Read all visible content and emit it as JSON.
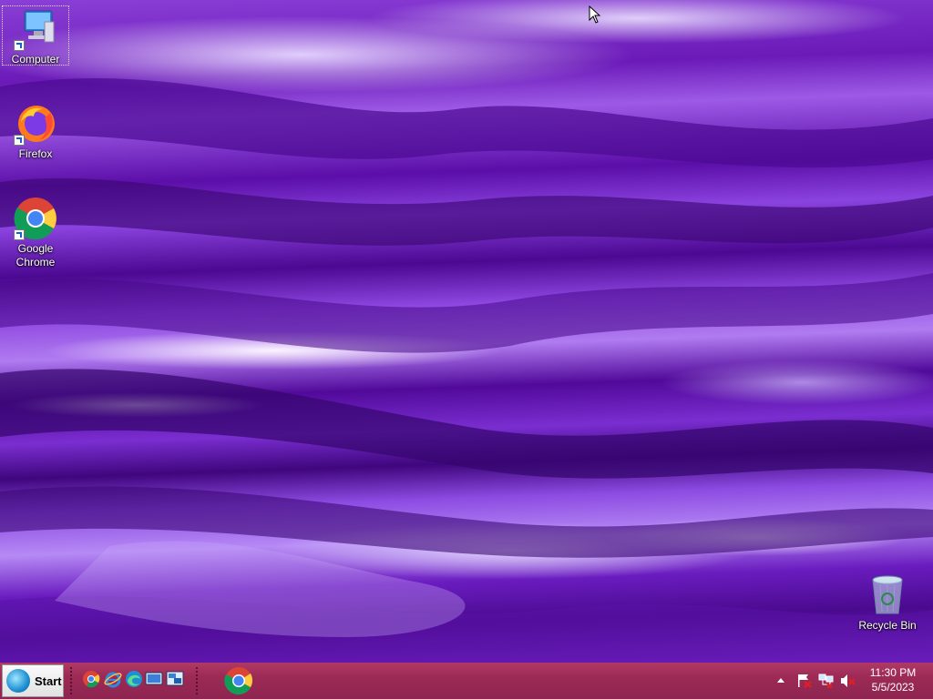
{
  "desktop": {
    "icons": [
      {
        "label": "Computer"
      },
      {
        "label": "Firefox"
      },
      {
        "label": "Google\nChrome"
      },
      {
        "label": "Recycle Bin"
      }
    ]
  },
  "taskbar": {
    "start_label": "Start",
    "quick_launch": [
      "chrome-icon",
      "internet-explorer-icon",
      "edge-icon",
      "desktop-icon",
      "switch-windows-icon"
    ],
    "pinned": [
      "chrome-icon"
    ],
    "tray_icons": [
      "show-hidden-icons-arrow",
      "action-center-flag-icon",
      "network-icon",
      "volume-muted-icon"
    ],
    "clock": {
      "time": "11:30 PM",
      "date": "5/5/2023"
    }
  },
  "colors": {
    "taskbar": "#9c2a55",
    "wallpaper": "#6b1ab8"
  }
}
